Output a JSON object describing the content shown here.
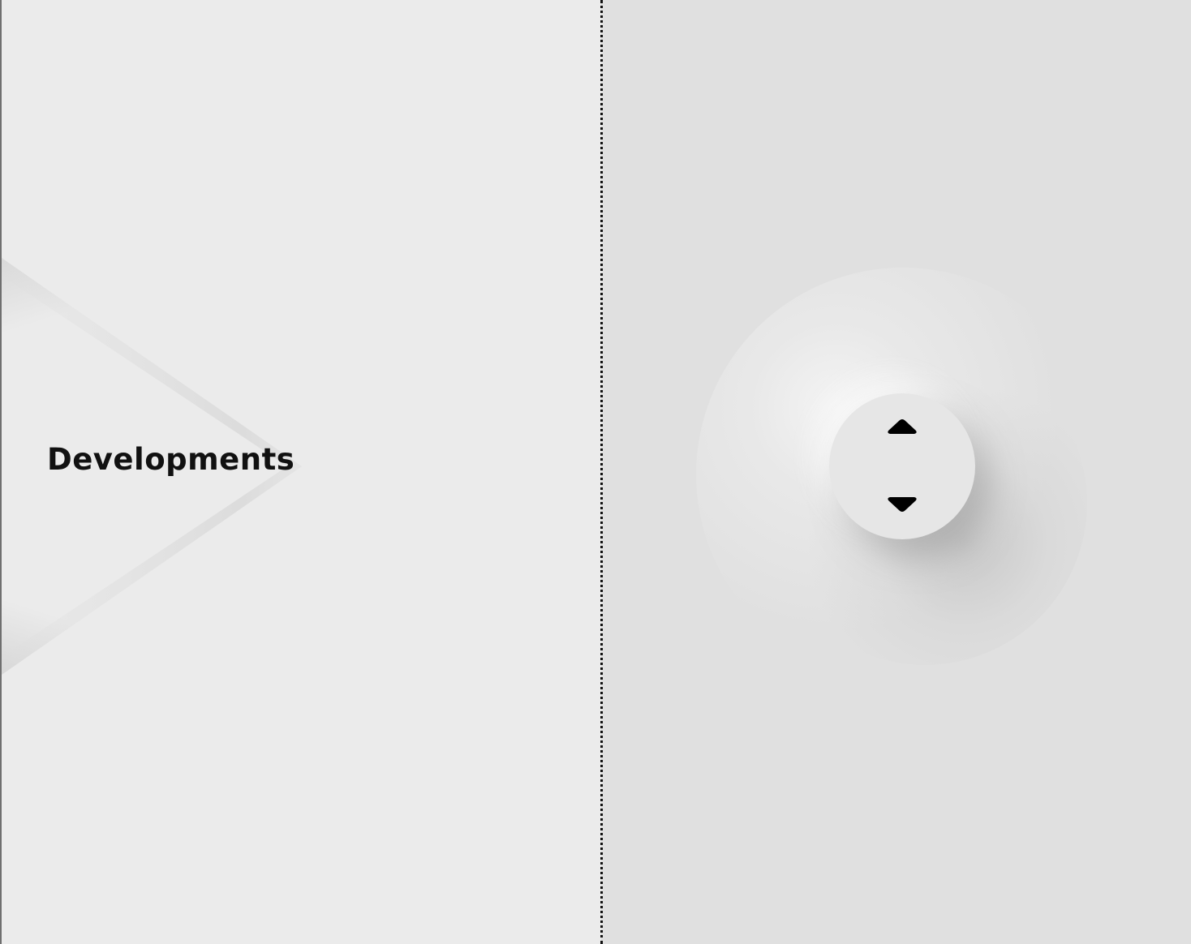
{
  "left_panel": {
    "arrow_label": "Developments"
  },
  "right_panel": {
    "spinner": {
      "up_icon": "caret-up-icon",
      "down_icon": "caret-down-icon"
    }
  },
  "colors": {
    "left_background": "#ebebeb",
    "right_background": "#e0e0e0",
    "divider": "#111111",
    "icon": "#000000",
    "text": "#111111"
  }
}
